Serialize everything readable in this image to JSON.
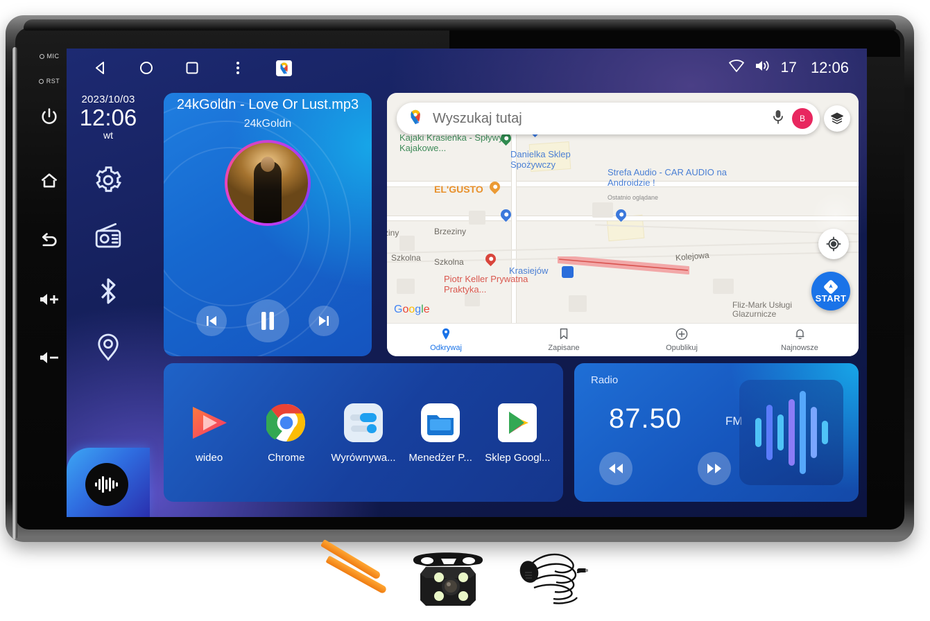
{
  "device": {
    "hw_buttons": [
      {
        "name": "mic",
        "label": "MIC"
      },
      {
        "name": "reset",
        "label": "RST"
      },
      {
        "name": "power",
        "label": ""
      },
      {
        "name": "home",
        "label": ""
      },
      {
        "name": "back",
        "label": ""
      },
      {
        "name": "volume-up",
        "label": ""
      },
      {
        "name": "volume-down",
        "label": ""
      }
    ]
  },
  "statusbar": {
    "nav": [
      {
        "icon": "back-triangle-icon",
        "label": "Back"
      },
      {
        "icon": "home-circle-icon",
        "label": "Home"
      },
      {
        "icon": "recents-square-icon",
        "label": "Recents"
      },
      {
        "icon": "overflow-menu-icon",
        "label": "More"
      },
      {
        "icon": "google-maps-icon",
        "label": "Maps"
      }
    ],
    "wifi_icon": "wifi-icon",
    "volume_icon": "volume-icon",
    "volume_level": "17",
    "time": "12:06"
  },
  "dock": {
    "date": "2023/10/03",
    "time": "12:06",
    "weekday": "wt",
    "items": [
      {
        "icon": "settings-gear-icon",
        "label": "Settings"
      },
      {
        "icon": "radio-icon",
        "label": "Radio"
      },
      {
        "icon": "bluetooth-icon",
        "label": "Bluetooth"
      },
      {
        "icon": "location-pin-icon",
        "label": "Navigation"
      }
    ],
    "assistant_icon": "voice-waveform-icon"
  },
  "music": {
    "title": "24kGoldn - Love Or Lust.mp3",
    "artist": "24kGoldn",
    "prev_icon": "skip-previous-icon",
    "play_icon": "pause-icon",
    "next_icon": "skip-next-icon"
  },
  "map": {
    "search": {
      "placeholder": "Wyszukaj tutaj",
      "logo_icon": "google-maps-pin-icon",
      "mic_icon": "microphone-icon",
      "avatar_initial": "B"
    },
    "layers_icon": "map-layers-icon",
    "locate_icon": "my-location-icon",
    "start_button": {
      "label": "START",
      "icon": "navigation-arrow-icon"
    },
    "watermark": "Google",
    "pois": [
      {
        "name": "Kajaki Krasieńka - Spływy Kajakowe...",
        "color": "green"
      },
      {
        "name": "Danielka Sklep Spożywczy",
        "color": "blue"
      },
      {
        "name": "Strefa Audio - CAR AUDIO na Androidzie !",
        "sub": "Ostatnio oglądane",
        "color": "blue"
      },
      {
        "name": "EL'GUSTO",
        "color": "orange"
      },
      {
        "name": "Piotr Keller Prywatna Praktyka...",
        "color": "red"
      },
      {
        "name": "Krasiejów",
        "color": "blue"
      },
      {
        "name": "Fliz-Mark Usługi Glazurnicze",
        "color": "grey"
      }
    ],
    "streets": [
      "Brzeziny",
      "ziny",
      "Szkolna",
      "Szkolna",
      "Kolejowa"
    ],
    "bottom_nav": [
      {
        "label": "Odkrywaj",
        "icon": "explore-pin-icon",
        "active": true
      },
      {
        "label": "Zapisane",
        "icon": "bookmark-icon",
        "active": false
      },
      {
        "label": "Opublikuj",
        "icon": "plus-circle-icon",
        "active": false
      },
      {
        "label": "Najnowsze",
        "icon": "bell-icon",
        "active": false
      }
    ]
  },
  "apps": [
    {
      "label": "wideo",
      "icon": "video-player-icon"
    },
    {
      "label": "Chrome",
      "icon": "chrome-icon"
    },
    {
      "label": "Wyrównywa...",
      "icon": "equalizer-icon"
    },
    {
      "label": "Menedżer P...",
      "icon": "file-manager-folder-icon"
    },
    {
      "label": "Sklep Googl...",
      "icon": "google-play-icon"
    }
  ],
  "radio": {
    "title": "Radio",
    "frequency": "87.50",
    "band": "FM",
    "prev_icon": "rewind-icon",
    "next_icon": "fast-forward-icon",
    "viz_icon": "audio-waveform-icon"
  },
  "accessories": [
    {
      "name": "pry-tools",
      "label": "Pry tools"
    },
    {
      "name": "reverse-camera",
      "label": "Reverse camera"
    },
    {
      "name": "external-microphone",
      "label": "External microphone"
    }
  ],
  "colors": {
    "accent_blue": "#1a73e8",
    "card_blue": "#1f6fd6",
    "avatar_pink": "#e8275f",
    "screen_bg": "#15205c"
  }
}
